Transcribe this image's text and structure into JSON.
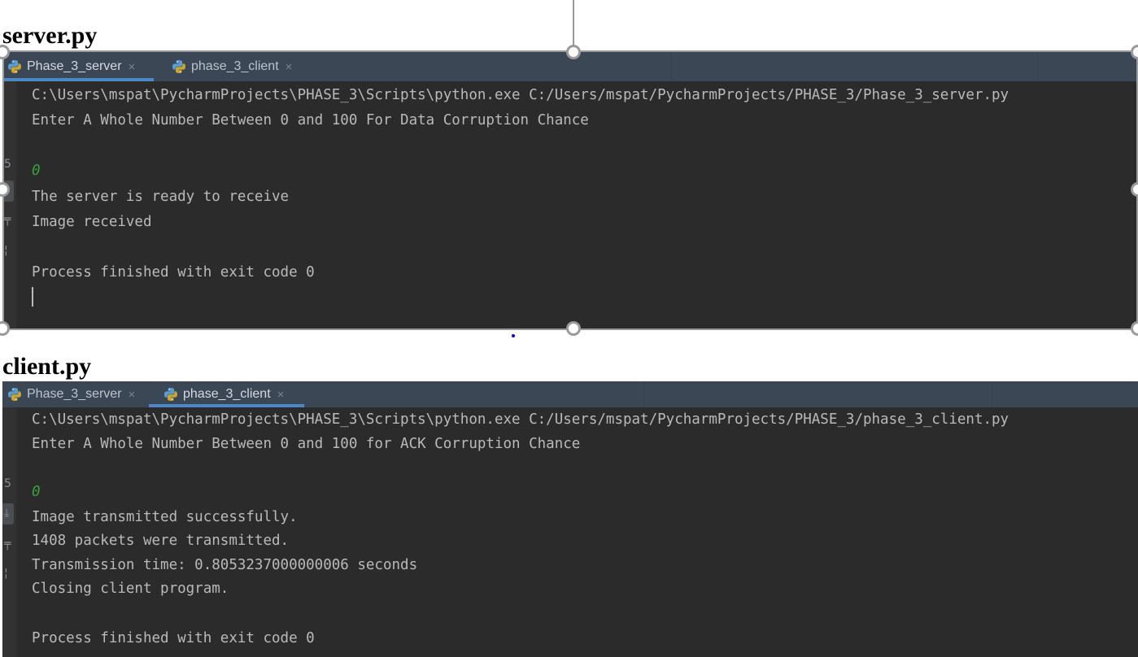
{
  "headings": {
    "server": "server.py",
    "client": "client.py"
  },
  "server_panel": {
    "tabs": [
      {
        "label": "Phase_3_server",
        "icon": "python-icon",
        "active": true,
        "close": "×"
      },
      {
        "label": "phase_3_client",
        "icon": "python-icon",
        "active": false,
        "close": "×"
      }
    ],
    "lines": [
      "C:\\Users\\mspat\\PycharmProjects\\PHASE_3\\Scripts\\python.exe C:/Users/mspat/PycharmProjects/PHASE_3/Phase_3_server.py",
      "Enter A Whole Number Between 0 and 100 For Data Corruption Chance",
      "",
      "0",
      "The server is ready to receive",
      "Image received",
      "",
      "Process finished with exit code 0"
    ],
    "user_input": "0"
  },
  "client_panel": {
    "tabs": [
      {
        "label": "Phase_3_server",
        "icon": "python-icon",
        "active": false,
        "close": "×"
      },
      {
        "label": "phase_3_client",
        "icon": "python-icon",
        "active": true,
        "close": "×"
      }
    ],
    "lines": [
      "C:\\Users\\mspat\\PycharmProjects\\PHASE_3\\Scripts\\python.exe C:/Users/mspat/PycharmProjects/PHASE_3/phase_3_client.py",
      "Enter A Whole Number Between 0 and 100 for ACK Corruption Chance",
      "",
      "0",
      "Image transmitted successfully.",
      "1408 packets were transmitted.",
      "Transmission time: 0.8053237000000006 seconds",
      "Closing client program.",
      "",
      "Process finished with exit code 0"
    ],
    "user_input": "0"
  },
  "gutter_icons": [
    "rerun-icon",
    "scroll-to-end-icon",
    "print-icon",
    "delete-icon"
  ]
}
